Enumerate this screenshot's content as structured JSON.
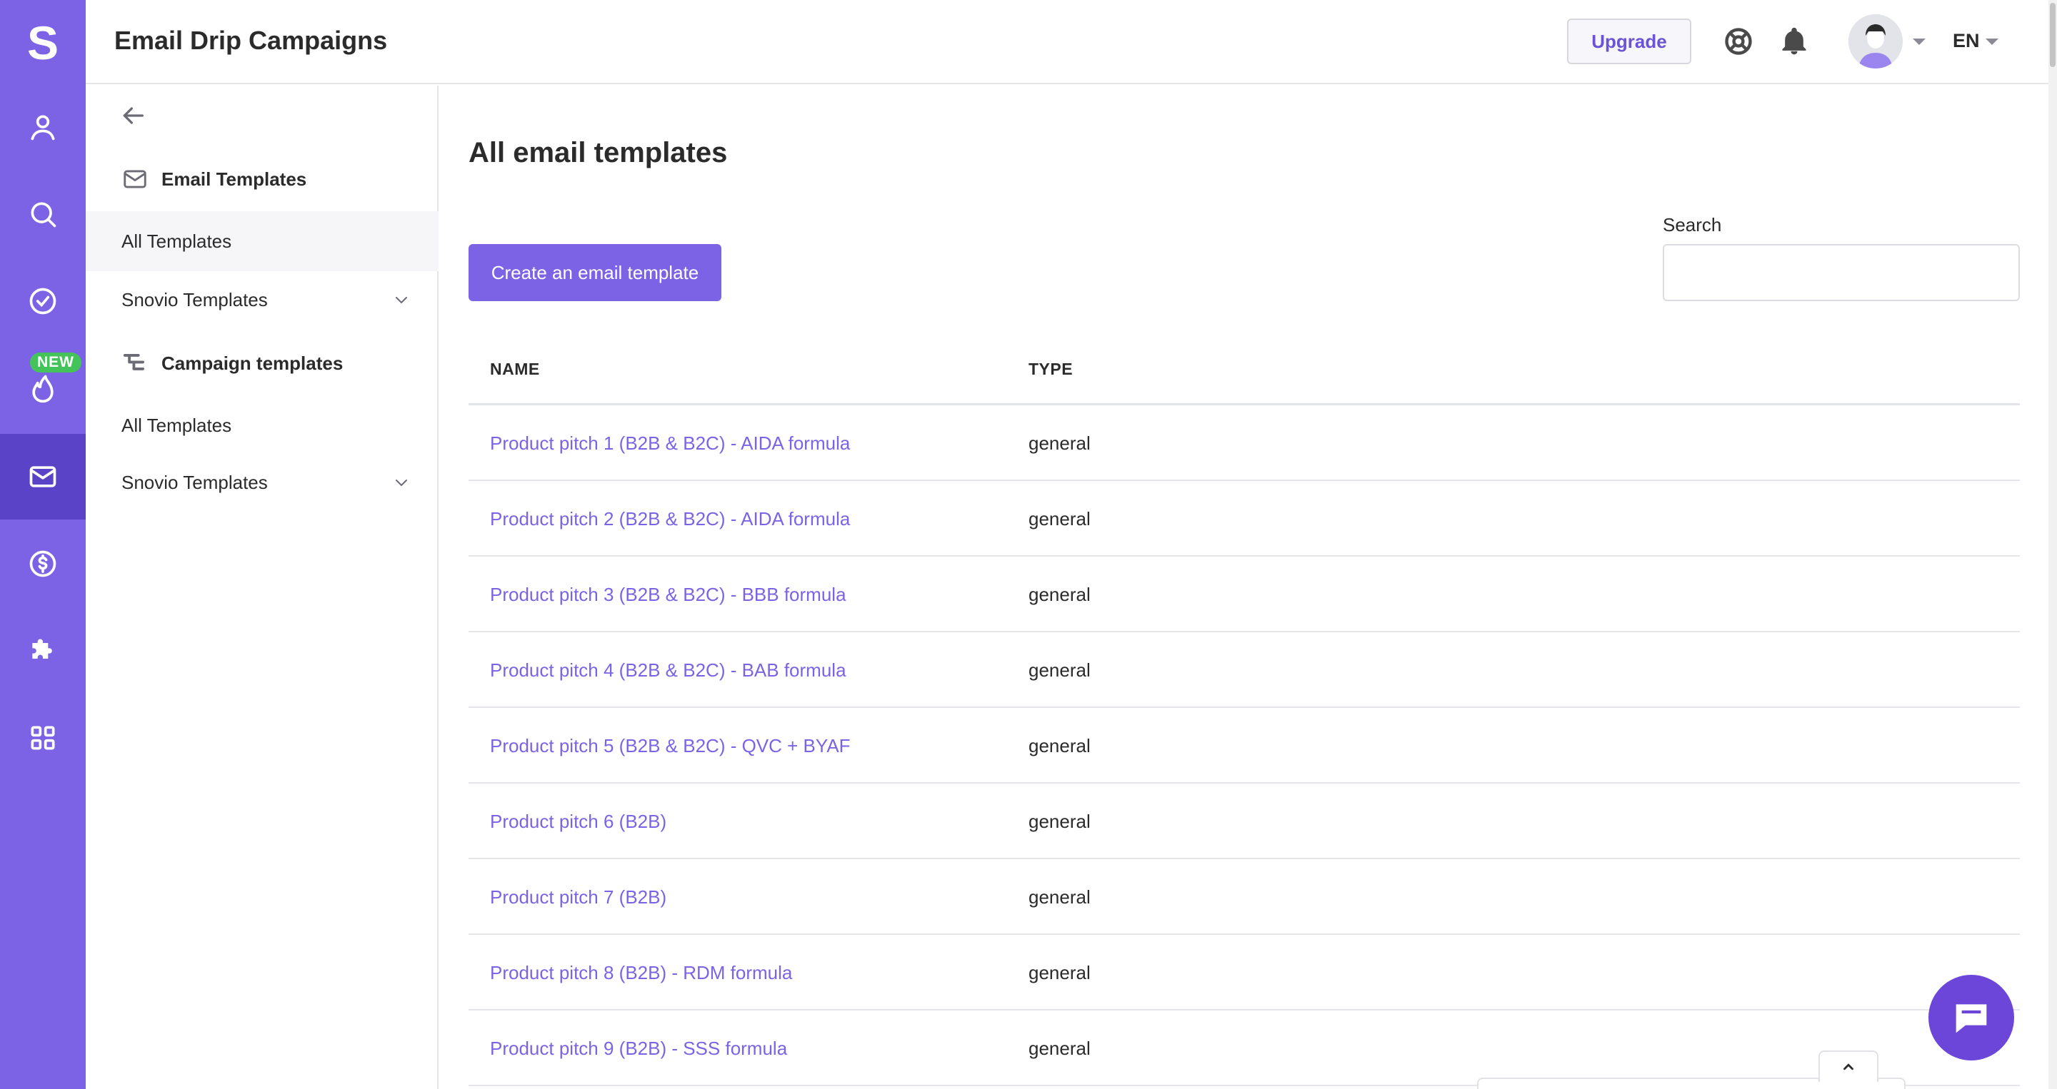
{
  "app": {
    "logo": "S",
    "title": "Email Drip Campaigns"
  },
  "rail": {
    "items": [
      {
        "icon": "person-icon",
        "label": ""
      },
      {
        "icon": "search-icon",
        "label": ""
      },
      {
        "icon": "check-circle-icon",
        "label": ""
      },
      {
        "icon": "flame-icon",
        "badge": "NEW"
      },
      {
        "icon": "envelope-icon",
        "active": true
      },
      {
        "icon": "dollar-circle-icon"
      },
      {
        "icon": "puzzle-icon"
      },
      {
        "icon": "grid-icon"
      }
    ],
    "accent": "#7c63e6",
    "active_bg": "#5b43c8",
    "badge_color": "#44c35a"
  },
  "header": {
    "upgrade_label": "Upgrade",
    "help_icon": "lifebuoy-icon",
    "notification_icon": "bell-icon",
    "language": "EN"
  },
  "subnav": {
    "email_section": {
      "title": "Email Templates",
      "items": [
        {
          "label": "All Templates",
          "selected": true
        },
        {
          "label": "Snovio Templates",
          "expandable": true
        }
      ]
    },
    "campaign_section": {
      "title": "Campaign templates",
      "items": [
        {
          "label": "All Templates"
        },
        {
          "label": "Snovio Templates",
          "expandable": true
        }
      ]
    }
  },
  "main": {
    "title": "All email templates",
    "create_label": "Create an email template",
    "search_label": "Search",
    "search_value": "",
    "search_placeholder": "",
    "columns": {
      "name": "NAME",
      "type": "TYPE"
    },
    "rows": [
      {
        "name": "Product pitch 1 (B2B & B2C) - AIDA formula",
        "type": "general"
      },
      {
        "name": "Product pitch 2 (B2B & B2C) - AIDA formula",
        "type": "general"
      },
      {
        "name": "Product pitch 3 (B2B & B2C) - BBB formula",
        "type": "general"
      },
      {
        "name": "Product pitch 4 (B2B & B2C) - BAB formula",
        "type": "general"
      },
      {
        "name": "Product pitch 5 (B2B & B2C) - QVC + BYAF",
        "type": "general"
      },
      {
        "name": "Product pitch 6 (B2B)",
        "type": "general"
      },
      {
        "name": "Product pitch 7 (B2B)",
        "type": "general"
      },
      {
        "name": "Product pitch 8 (B2B) - RDM formula",
        "type": "general"
      },
      {
        "name": "Product pitch 9 (B2B) - SSS formula",
        "type": "general"
      }
    ]
  },
  "floating": {
    "chat_icon": "chat-bubble-icon",
    "collapse_icon": "chevron-up-icon"
  }
}
